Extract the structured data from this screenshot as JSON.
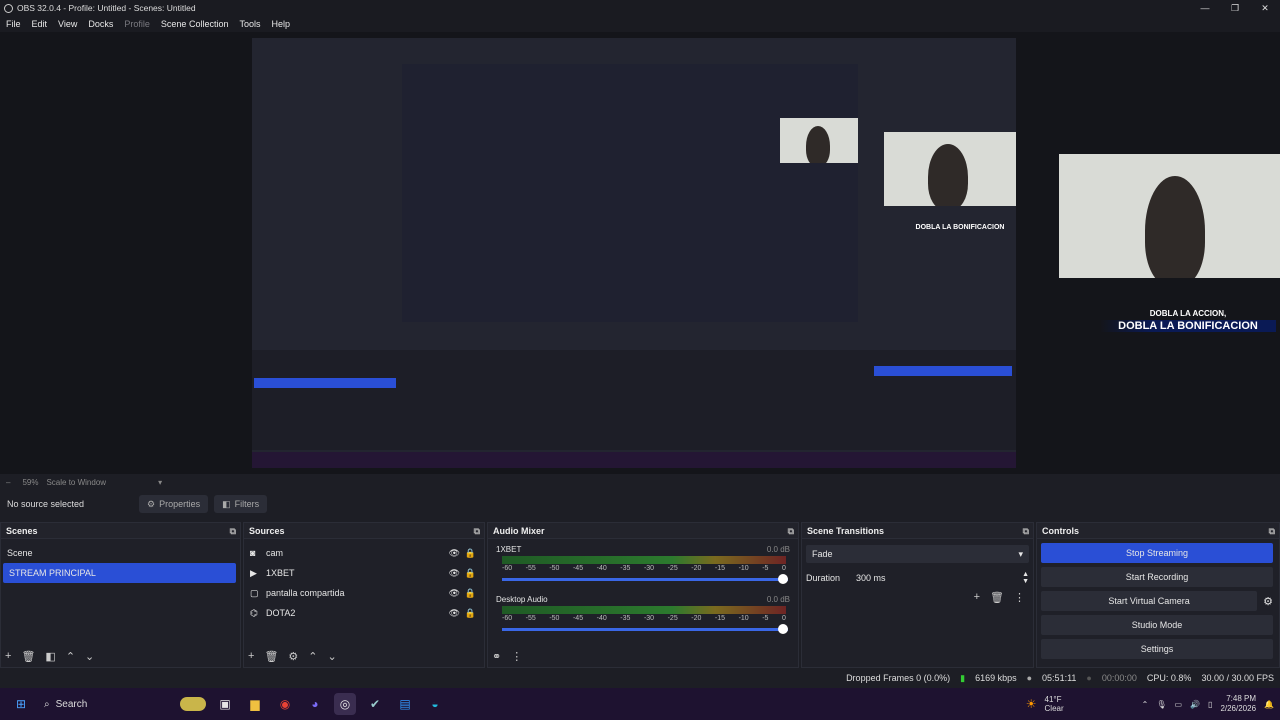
{
  "window": {
    "title": "OBS 32.0.4 - Profile: Untitled - Scenes: Untitled"
  },
  "menu": {
    "items": [
      "File",
      "Edit",
      "View",
      "Docks",
      "Profile",
      "Scene Collection",
      "Tools",
      "Help"
    ]
  },
  "preview": {
    "banner_small": "DOBLA LA ACCION,",
    "banner_big": "DOBLA LA BONIFICACION"
  },
  "scale": {
    "percent": "59%",
    "mode": "Scale to Window"
  },
  "source_bar": {
    "status": "No source selected",
    "properties": "Properties",
    "filters": "Filters"
  },
  "scenes": {
    "title": "Scenes",
    "items": [
      "Scene",
      "STREAM PRINCIPAL"
    ],
    "selected": 1
  },
  "sources": {
    "title": "Sources",
    "items": [
      {
        "icon": "camera-icon",
        "label": "cam"
      },
      {
        "icon": "play-icon",
        "label": "1XBET"
      },
      {
        "icon": "window-icon",
        "label": "pantalla compartida"
      },
      {
        "icon": "gamepad-icon",
        "label": "DOTA2"
      }
    ]
  },
  "audio_mixer": {
    "title": "Audio Mixer",
    "channels": [
      {
        "name": "1XBET",
        "db": "0.0 dB"
      },
      {
        "name": "Desktop Audio",
        "db": "0.0 dB"
      }
    ],
    "ticks": [
      "-60",
      "-55",
      "-50",
      "-45",
      "-40",
      "-35",
      "-30",
      "-25",
      "-20",
      "-15",
      "-10",
      "-5",
      "0"
    ]
  },
  "transitions": {
    "title": "Scene Transitions",
    "selected": "Fade",
    "duration_label": "Duration",
    "duration_value": "300 ms"
  },
  "controls": {
    "title": "Controls",
    "buttons": [
      "Stop Streaming",
      "Start Recording",
      "Start Virtual Camera",
      "Studio Mode",
      "Settings"
    ]
  },
  "status": {
    "dropped": "Dropped Frames 0 (0.0%)",
    "bitrate": "6169 kbps",
    "stream_time": "05:51:11",
    "rec_time": "00:00:00",
    "cpu": "CPU: 0.8%",
    "fps": "30.00 / 30.00 FPS"
  },
  "taskbar": {
    "search": "Search",
    "weather_temp": "41°F",
    "weather_desc": "Clear",
    "time": "7:48 PM",
    "date": "2/26/2026"
  },
  "colors": {
    "accent": "#2a4fd6",
    "bg": "#1d1e25",
    "taskbar": "#1e1230"
  }
}
